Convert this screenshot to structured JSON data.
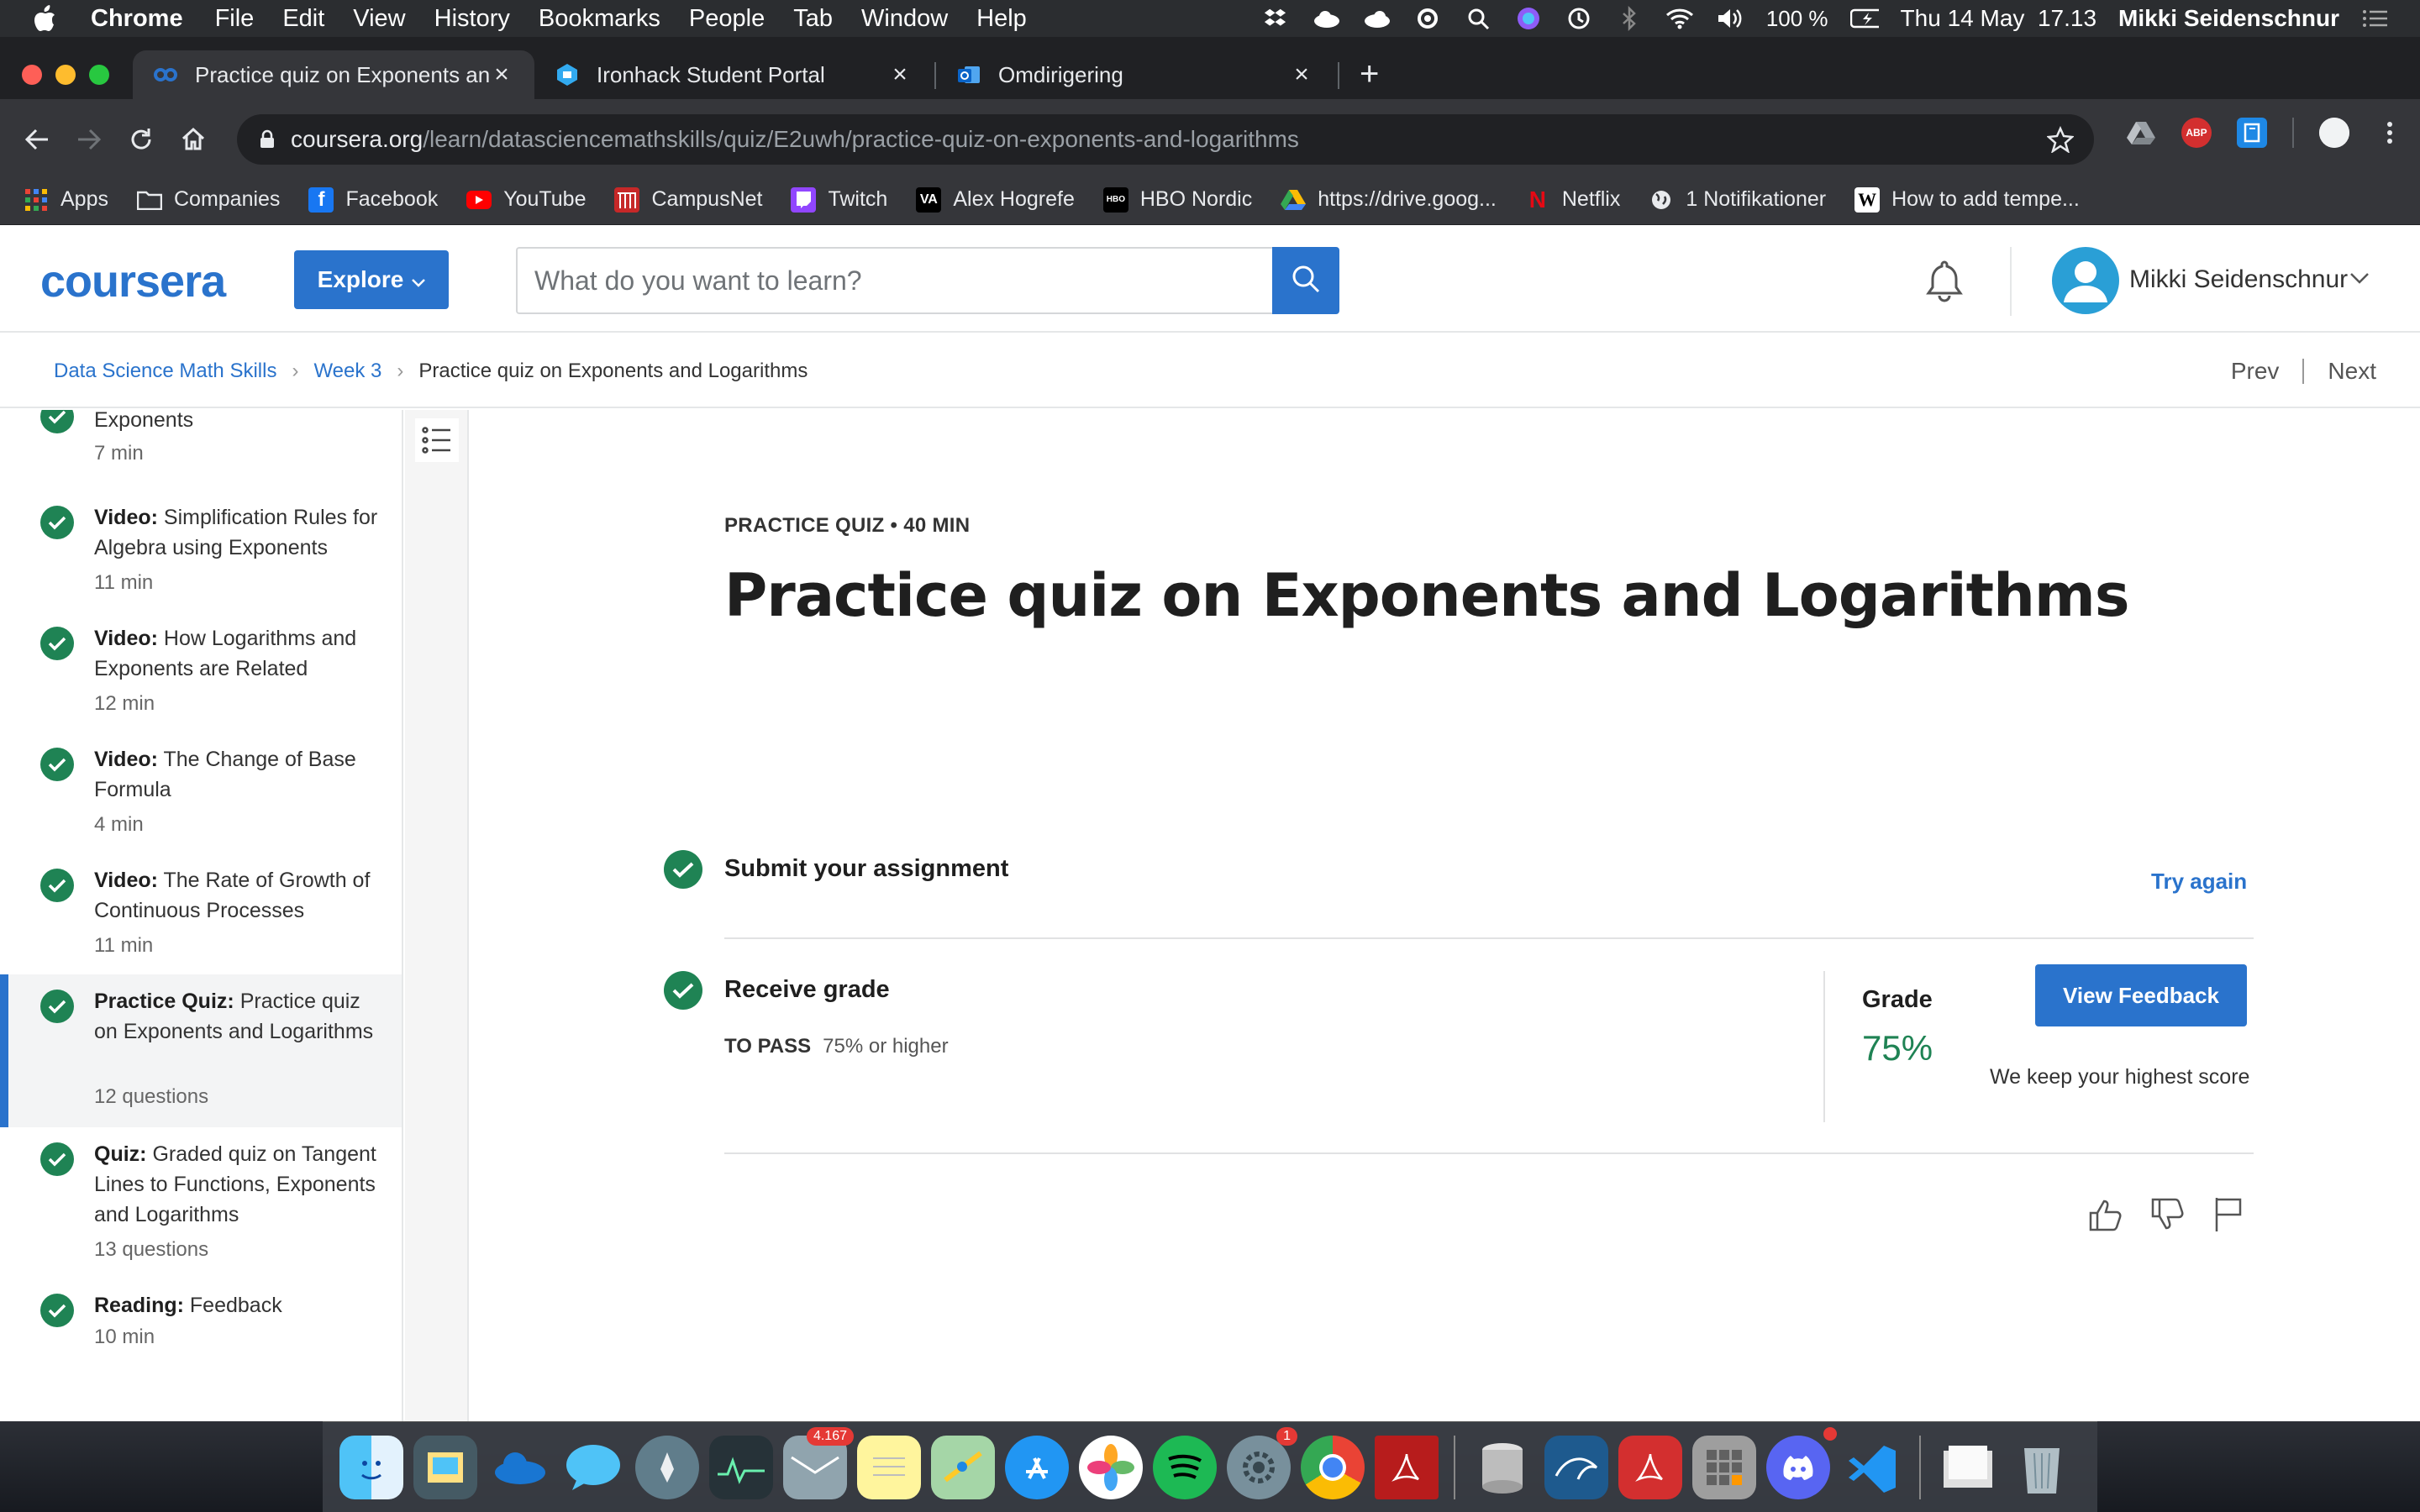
{
  "menubar": {
    "app_name": "Chrome",
    "menus": [
      "File",
      "Edit",
      "View",
      "History",
      "Bookmarks",
      "People",
      "Tab",
      "Window",
      "Help"
    ],
    "battery": "100 %",
    "datetime": "Thu 14 May  17.13",
    "user": "Mikki Seidenschnur"
  },
  "browser": {
    "tabs": [
      {
        "title": "Practice quiz on Exponents and Logarithms",
        "icon": "coursera-icon",
        "active": true
      },
      {
        "title": "Ironhack Student Portal",
        "icon": "ironhack-icon",
        "active": false
      },
      {
        "title": "Omdirigering",
        "icon": "outlook-icon",
        "active": false
      }
    ],
    "url_host": "coursera.org",
    "url_path": "/learn/datasciencemathskills/quiz/E2uwh/practice-quiz-on-exponents-and-logarithms",
    "extensions": [
      "drive-icon",
      "ABP",
      "bookmark-ext-icon",
      "profile-icon"
    ],
    "bookmarks": [
      {
        "label": "Apps",
        "icon": "apps-grid-icon"
      },
      {
        "label": "Companies",
        "icon": "folder-icon"
      },
      {
        "label": "Facebook",
        "icon": "facebook-icon"
      },
      {
        "label": "YouTube",
        "icon": "youtube-icon"
      },
      {
        "label": "CampusNet",
        "icon": "campusnet-icon"
      },
      {
        "label": "Twitch",
        "icon": "twitch-icon"
      },
      {
        "label": "Alex Hogrefe",
        "icon": "va-icon"
      },
      {
        "label": "HBO Nordic",
        "icon": "hbo-icon"
      },
      {
        "label": "https://drive.goog...",
        "icon": "drive-icon"
      },
      {
        "label": "Netflix",
        "icon": "netflix-icon"
      },
      {
        "label": "1 Notifikationer",
        "icon": "globe-icon"
      },
      {
        "label": "How to add tempe...",
        "icon": "wikipedia-icon"
      }
    ]
  },
  "coursera": {
    "logo": "coursera",
    "explore_label": "Explore",
    "search_placeholder": "What do you want to learn?",
    "user_name": "Mikki Seidenschnur",
    "breadcrumbs": [
      "Data Science Math Skills",
      "Week 3",
      "Practice quiz on Exponents and Logarithms"
    ],
    "prev_label": "Prev",
    "next_label": "Next"
  },
  "sidebar": {
    "items": [
      {
        "prefix": "",
        "title": "Exponents",
        "meta": "7 min",
        "active": false
      },
      {
        "prefix": "Video:",
        "title": "Simplification Rules for Algebra using Exponents",
        "meta": "11 min",
        "active": false
      },
      {
        "prefix": "Video:",
        "title": "How Logarithms and Exponents are Related",
        "meta": "12 min",
        "active": false
      },
      {
        "prefix": "Video:",
        "title": "The Change of Base Formula",
        "meta": "4 min",
        "active": false
      },
      {
        "prefix": "Video:",
        "title": "The Rate of Growth of Continuous Processes",
        "meta": "11 min",
        "active": false
      },
      {
        "prefix": "Practice Quiz:",
        "title": "Practice quiz on Exponents and Logarithms",
        "meta": "12 questions",
        "active": true
      },
      {
        "prefix": "Quiz:",
        "title": "Graded quiz on Tangent Lines to Functions, Exponents and Logarithms",
        "meta": "13 questions",
        "active": false
      },
      {
        "prefix": "Reading:",
        "title": "Feedback",
        "meta": "10 min",
        "active": false
      }
    ]
  },
  "quiz": {
    "kicker": "PRACTICE QUIZ • 40 MIN",
    "title": "Practice quiz on Exponents and Logarithms",
    "submit_step": "Submit your assignment",
    "try_again": "Try again",
    "receive_step": "Receive grade",
    "to_pass_label": "TO PASS",
    "to_pass_value": "75% or higher",
    "grade_label": "Grade",
    "grade_value": "75%",
    "feedback_button": "View Feedback",
    "score_note": "We keep your highest score"
  },
  "dock": {
    "apps": [
      "finder",
      "preview",
      "onedrive",
      "messages",
      "launchpad",
      "activity-monitor",
      "mail",
      "notes",
      "maps",
      "app-store",
      "photos",
      "spotify",
      "system-preferences",
      "chrome",
      "acrobat",
      "sequel",
      "mysql-workbench",
      "acrobat-reader",
      "calculator",
      "discord",
      "vscode",
      "documents",
      "trash"
    ],
    "mail_badge": "4.167",
    "sysprefs_badge": "1"
  }
}
